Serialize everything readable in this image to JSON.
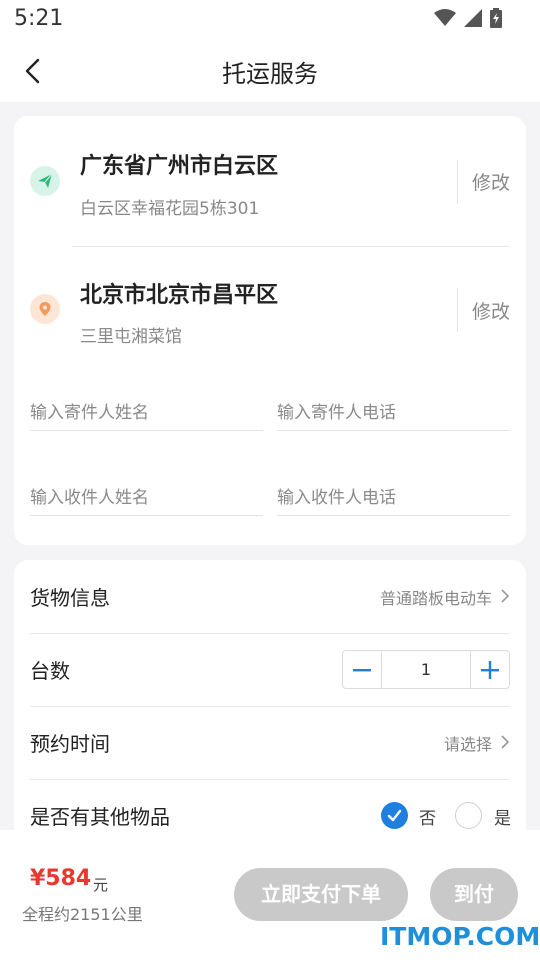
{
  "status_bar": {
    "time": "5:21",
    "icons": [
      "wifi-icon",
      "signal-icon",
      "battery-icon"
    ]
  },
  "nav": {
    "title": "托运服务",
    "back_icon": "chevron-left-icon"
  },
  "origin": {
    "title": "广东省广州市白云区",
    "detail": "白云区幸福花园5栋301",
    "edit_label": "修改",
    "icon": "send-icon",
    "icon_color": "#2fb87a"
  },
  "destination": {
    "title": "北京市北京市昌平区",
    "detail": "三里屯湘菜馆",
    "edit_label": "修改",
    "icon": "location-pin-icon",
    "icon_color": "#f29a5c"
  },
  "contacts": {
    "sender_name_placeholder": "输入寄件人姓名",
    "sender_phone_placeholder": "输入寄件人电话",
    "receiver_name_placeholder": "输入收件人姓名",
    "receiver_phone_placeholder": "输入收件人电话"
  },
  "goods": {
    "info_label": "货物信息",
    "info_value": "普通踏板电动车",
    "count_label": "台数",
    "count_value": "1",
    "time_label": "预约时间",
    "time_value": "请选择",
    "other_label": "是否有其他物品",
    "option_no": "否",
    "option_yes": "是",
    "selected": "否"
  },
  "footer": {
    "price": "¥584",
    "price_unit": "元",
    "distance": "全程约2151公里",
    "pay_label": "立即支付下单",
    "cod_label": "到付"
  },
  "watermark": "ITMOP.COM",
  "colors": {
    "accent": "#1e7fe0",
    "price": "#e8382f",
    "disabled": "#c9c9c9"
  }
}
